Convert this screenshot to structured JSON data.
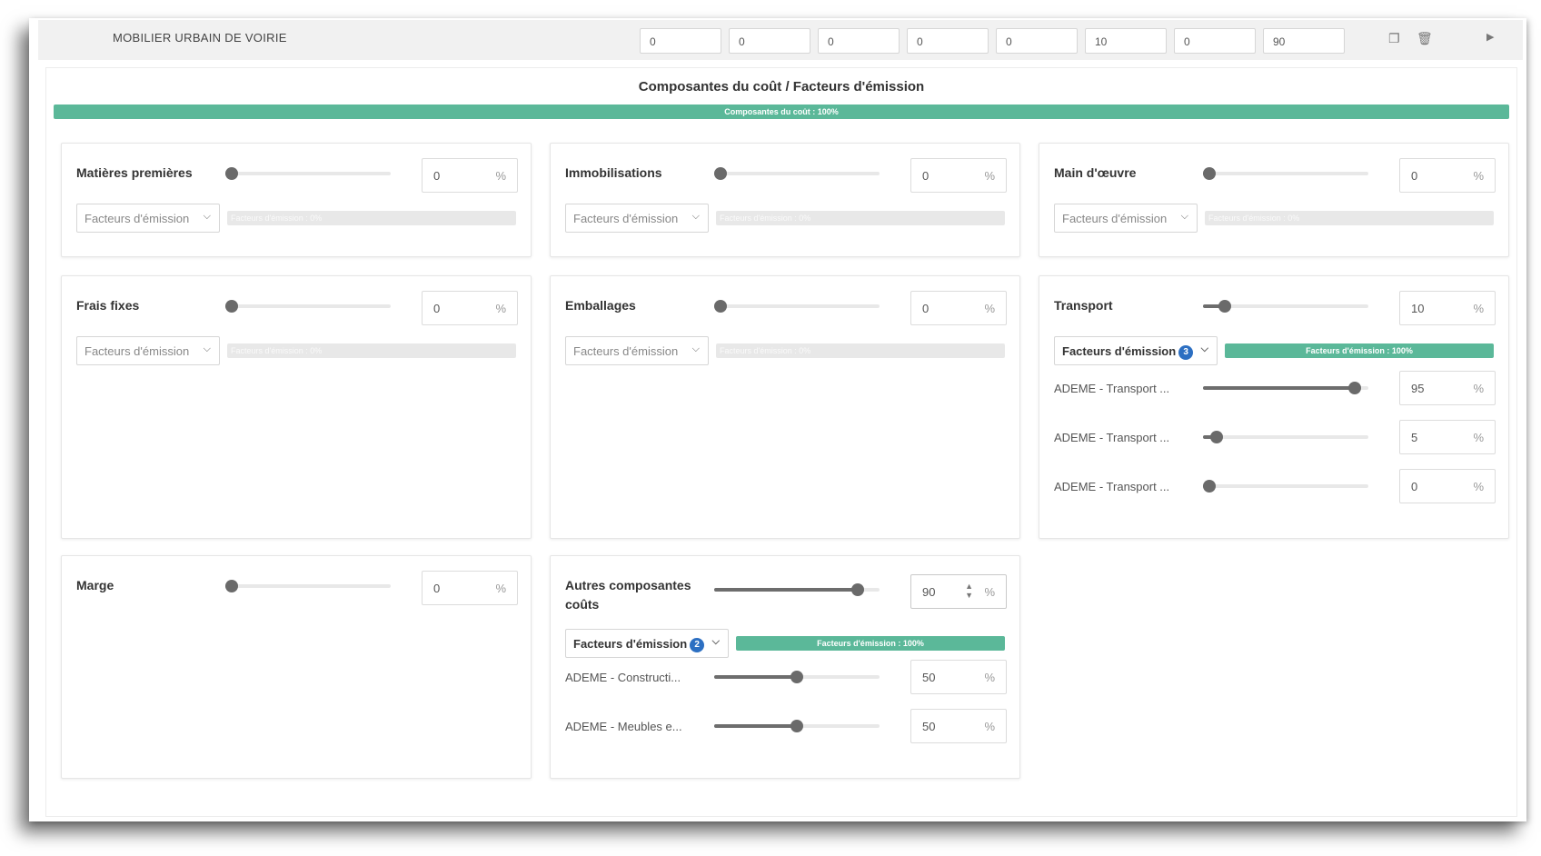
{
  "header": {
    "title": "MOBILIER URBAIN DE VOIRIE",
    "inputs": [
      "0",
      "0",
      "0",
      "0",
      "0",
      "10",
      "0",
      "90"
    ],
    "icons": [
      "copy-icon",
      "trash-icon",
      "arrow-right-icon"
    ]
  },
  "section": {
    "title": "Composantes du coût / Facteurs d'émission",
    "progress_label": "Composantes du coût : 100%",
    "progress_percent": 100
  },
  "common": {
    "dropdown_label": "Facteurs d'émission",
    "percent_unit": "%",
    "empty_bar_label": "Facteurs d'émission : 0%",
    "full_bar_label": "Facteurs d'émission : 100%"
  },
  "cards": {
    "matieres": {
      "title": "Matières premières",
      "value": "0",
      "slider": 0
    },
    "immobilisations": {
      "title": "Immobilisations",
      "value": "0",
      "slider": 0
    },
    "main_oeuvre": {
      "title": "Main d'œuvre",
      "value": "0",
      "slider": 0
    },
    "frais_fixes": {
      "title": "Frais fixes",
      "value": "0",
      "slider": 0
    },
    "emballages": {
      "title": "Emballages",
      "value": "0",
      "slider": 0
    },
    "transport": {
      "title": "Transport",
      "value": "10",
      "slider": 10,
      "badge": "3",
      "factors": [
        {
          "label": "ADEME - Transport ...",
          "value": "95",
          "slider": 95
        },
        {
          "label": "ADEME - Transport ...",
          "value": "5",
          "slider": 5
        },
        {
          "label": "ADEME - Transport ...",
          "value": "0",
          "slider": 0
        }
      ]
    },
    "marge": {
      "title": "Marge",
      "value": "0",
      "slider": 0
    },
    "autres": {
      "title_line1": "Autres composantes",
      "title_line2": "coûts",
      "value": "90",
      "slider": 90,
      "badge": "2",
      "factors": [
        {
          "label": "ADEME - Constructi...",
          "value": "50",
          "slider": 50
        },
        {
          "label": "ADEME - Meubles e...",
          "value": "50",
          "slider": 50
        }
      ]
    }
  }
}
